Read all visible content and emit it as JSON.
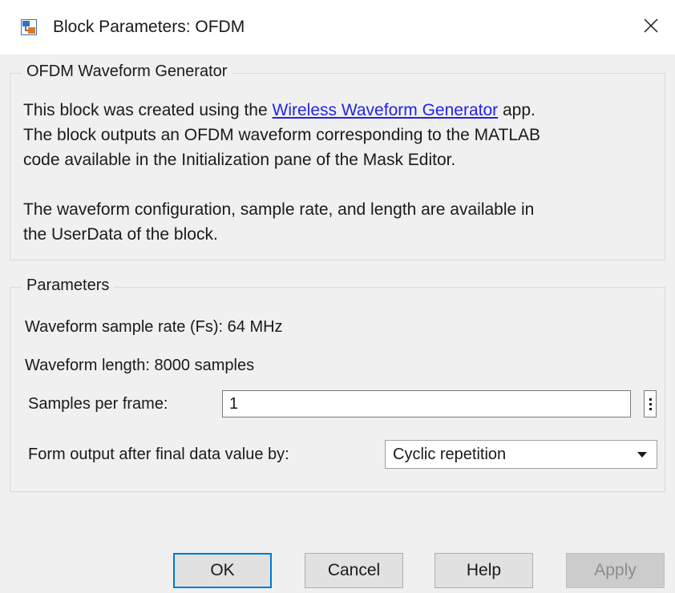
{
  "window": {
    "title": "Block Parameters: OFDM",
    "icon": "simulink-block-icon",
    "close_icon": "close-icon"
  },
  "description": {
    "legend": "OFDM Waveform Generator",
    "line1_before": "This block was created using the ",
    "link_text": "Wireless Waveform Generator",
    "line1_after": " app.",
    "line2": "The block outputs an OFDM waveform corresponding to the MATLAB",
    "line3": "code available in the Initialization pane of the Mask Editor.",
    "line4": "The waveform configuration, sample rate, and length are available in",
    "line5": "the UserData of the block."
  },
  "parameters": {
    "legend": "Parameters",
    "sample_rate": "Waveform sample rate (Fs): 64 MHz",
    "length": "Waveform length: 8000 samples",
    "samples_per_frame": {
      "label": "Samples per frame:",
      "value": "1",
      "more_icon": "vertical-ellipsis-icon"
    },
    "form_output": {
      "label": "Form output after final data value by:",
      "selected": "Cyclic repetition",
      "caret_icon": "dropdown-arrow-icon"
    }
  },
  "buttons": {
    "ok": "OK",
    "cancel": "Cancel",
    "help": "Help",
    "apply": "Apply",
    "apply_enabled": false
  },
  "colors": {
    "background": "#f0f0f0",
    "link": "#2323e6",
    "focus_border": "#0078d7",
    "disabled_text": "#8c8c8c"
  }
}
